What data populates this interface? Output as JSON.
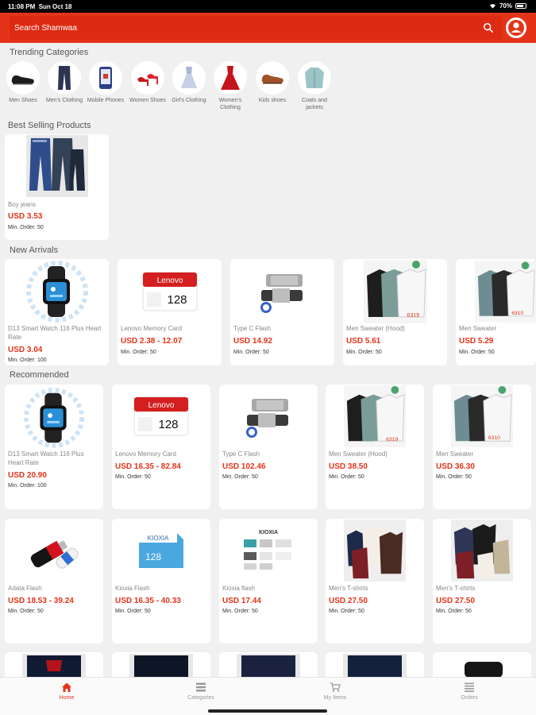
{
  "status": {
    "time": "11:08 PM",
    "date": "Sun Oct 18",
    "battery": "70%"
  },
  "search": {
    "placeholder": "Search Shamwaa"
  },
  "sections": {
    "trending": "Trending Categories",
    "best_selling": "Best Selling Products",
    "new_arrivals": "New Arrivals",
    "recommended": "Recommended"
  },
  "categories": [
    {
      "label": "Men Shoes",
      "icon": "shoe-icon"
    },
    {
      "label": "Men's Clothing",
      "icon": "trousers-icon"
    },
    {
      "label": "Mobile Phones",
      "icon": "phone-icon"
    },
    {
      "label": "Women Shoes",
      "icon": "heels-icon"
    },
    {
      "label": "Girl's Clothing",
      "icon": "dress-icon"
    },
    {
      "label": "Women's Clothing",
      "icon": "gown-icon"
    },
    {
      "label": "Kids shoes",
      "icon": "kids-shoe-icon"
    },
    {
      "label": "Coats and jackets",
      "icon": "jacket-icon"
    }
  ],
  "best_selling": [
    {
      "name": "Boy jeans",
      "price": "USD 3.53",
      "moq": "Min. Order: 50",
      "image": "jeans-image"
    }
  ],
  "new_arrivals": [
    {
      "name": "D13 Smart Watch 116 Plus Heart Rate",
      "price": "USD 3.04",
      "moq": "Min. Order: 100",
      "image": "smartwatch-image"
    },
    {
      "name": "Lenovo Memory Card",
      "price": "USD 2.38 - 12.07",
      "moq": "Min. Order: 50",
      "image": "memory-card-image",
      "brand": "Lenovo",
      "capacity": "128"
    },
    {
      "name": "Type C Flash",
      "price": "USD 14.92",
      "moq": "Min. Order: 50",
      "image": "flash-drive-image"
    },
    {
      "name": "Men Sweater (Hood)",
      "price": "USD 5.61",
      "moq": "Min. Order: 50",
      "image": "sweater-image"
    },
    {
      "name": "Men Sweater",
      "price": "USD 5.29",
      "moq": "Min. Order: 50",
      "image": "sweater-image"
    }
  ],
  "recommended": [
    {
      "name": "D13 Smart Watch 116 Plus Heart Rate",
      "price": "USD 20.90",
      "moq": "Min. Order: 100",
      "image": "smartwatch-image"
    },
    {
      "name": "Lenovo Memory Card",
      "price": "USD 16.35 - 82.84",
      "moq": "Min. Order: 50",
      "image": "memory-card-image",
      "brand": "Lenovo",
      "capacity": "128"
    },
    {
      "name": "Type C Flash",
      "price": "USD 102.46",
      "moq": "Min. Order: 50",
      "image": "flash-drive-image"
    },
    {
      "name": "Men Sweater (Hood)",
      "price": "USD 38.50",
      "moq": "Min. Order: 50",
      "image": "sweater-image"
    },
    {
      "name": "Men Sweater",
      "price": "USD 36.30",
      "moq": "Min. Order: 50",
      "image": "sweater-image"
    },
    {
      "name": "Adata Flash",
      "price": "USD 18.53 - 39.24",
      "moq": "Min. Order: 50",
      "image": "usb-stick-image"
    },
    {
      "name": "Kioxia Flash",
      "price": "USD 16.35 - 40.33",
      "moq": "Min. Order: 50",
      "image": "sd-card-image",
      "brand": "KIOXIA",
      "capacity": "128"
    },
    {
      "name": "Kioxia flash",
      "price": "USD 17.44",
      "moq": "Min. Order: 50",
      "image": "usb-set-image",
      "brand": "KIOXIA"
    },
    {
      "name": "Men's T-shirts",
      "price": "USD 27.50",
      "moq": "Min. Order: 50",
      "image": "tshirt-image"
    },
    {
      "name": "Men's T-shirts",
      "price": "USD 27.50",
      "moq": "Min. Order: 50",
      "image": "tshirt-image"
    }
  ],
  "nav": [
    {
      "label": "Home",
      "icon": "home-icon",
      "active": true
    },
    {
      "label": "Categories",
      "icon": "list-icon",
      "active": false
    },
    {
      "label": "My Items",
      "icon": "cart-icon",
      "active": false
    },
    {
      "label": "Orders",
      "icon": "orders-icon",
      "active": false
    }
  ],
  "colors": {
    "brand": "#e3341a",
    "background": "#f1f0f0",
    "card": "#ffffff"
  }
}
